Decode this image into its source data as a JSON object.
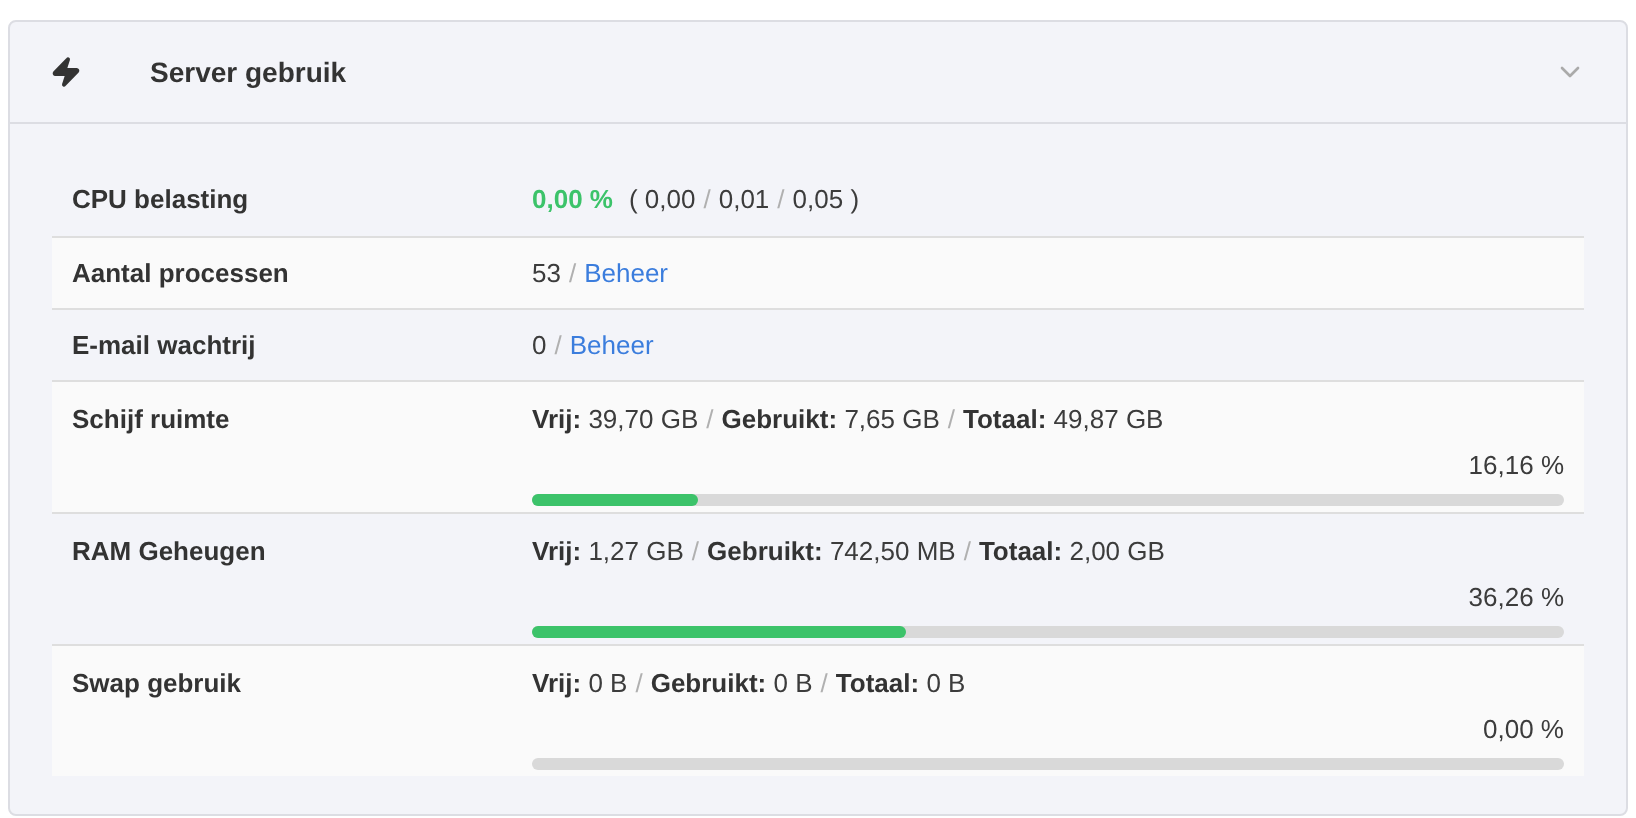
{
  "panel": {
    "title": "Server gebruik",
    "expanded": true
  },
  "rows": [
    {
      "kind": "plain",
      "label": "CPU belasting",
      "segments": [
        {
          "kind": "accent",
          "text": "0,00 %"
        },
        {
          "kind": "text",
          "text": "( 0,00"
        },
        {
          "kind": "sep",
          "text": "/"
        },
        {
          "kind": "text",
          "text": "0,01"
        },
        {
          "kind": "sep",
          "text": "/"
        },
        {
          "kind": "text",
          "text": "0,05 )"
        }
      ]
    },
    {
      "kind": "plain",
      "label": "Aantal processen",
      "segments": [
        {
          "kind": "text",
          "text": "53"
        },
        {
          "kind": "sep",
          "text": "/"
        },
        {
          "kind": "link",
          "text": "Beheer"
        }
      ]
    },
    {
      "kind": "plain",
      "label": "E-mail wachtrij",
      "segments": [
        {
          "kind": "text",
          "text": "0"
        },
        {
          "kind": "sep",
          "text": "/"
        },
        {
          "kind": "link",
          "text": "Beheer"
        }
      ]
    },
    {
      "kind": "usage",
      "label": "Schijf ruimte",
      "segments": [
        {
          "kind": "pair",
          "label": "Vrij:",
          "text": "39,70 GB"
        },
        {
          "kind": "sep",
          "text": "/"
        },
        {
          "kind": "pair",
          "label": "Gebruikt:",
          "text": "7,65 GB"
        },
        {
          "kind": "sep",
          "text": "/"
        },
        {
          "kind": "pair",
          "label": "Totaal:",
          "text": "49,87 GB"
        }
      ],
      "percent": "16,16 %",
      "level": 0.1616
    },
    {
      "kind": "usage",
      "label": "RAM Geheugen",
      "segments": [
        {
          "kind": "pair",
          "label": "Vrij:",
          "text": "1,27 GB"
        },
        {
          "kind": "sep",
          "text": "/"
        },
        {
          "kind": "pair",
          "label": "Gebruikt:",
          "text": "742,50 MB"
        },
        {
          "kind": "sep",
          "text": "/"
        },
        {
          "kind": "pair",
          "label": "Totaal:",
          "text": "2,00 GB"
        }
      ],
      "percent": "36,26 %",
      "level": 0.3626
    },
    {
      "kind": "usage",
      "label": "Swap gebruik",
      "segments": [
        {
          "kind": "pair",
          "label": "Vrij:",
          "text": "0 B"
        },
        {
          "kind": "sep",
          "text": "/"
        },
        {
          "kind": "pair",
          "label": "Gebruikt:",
          "text": "0 B"
        },
        {
          "kind": "sep",
          "text": "/"
        },
        {
          "kind": "pair",
          "label": "Totaal:",
          "text": "0 B"
        }
      ],
      "percent": "0,00 %",
      "level": 0
    }
  ]
}
